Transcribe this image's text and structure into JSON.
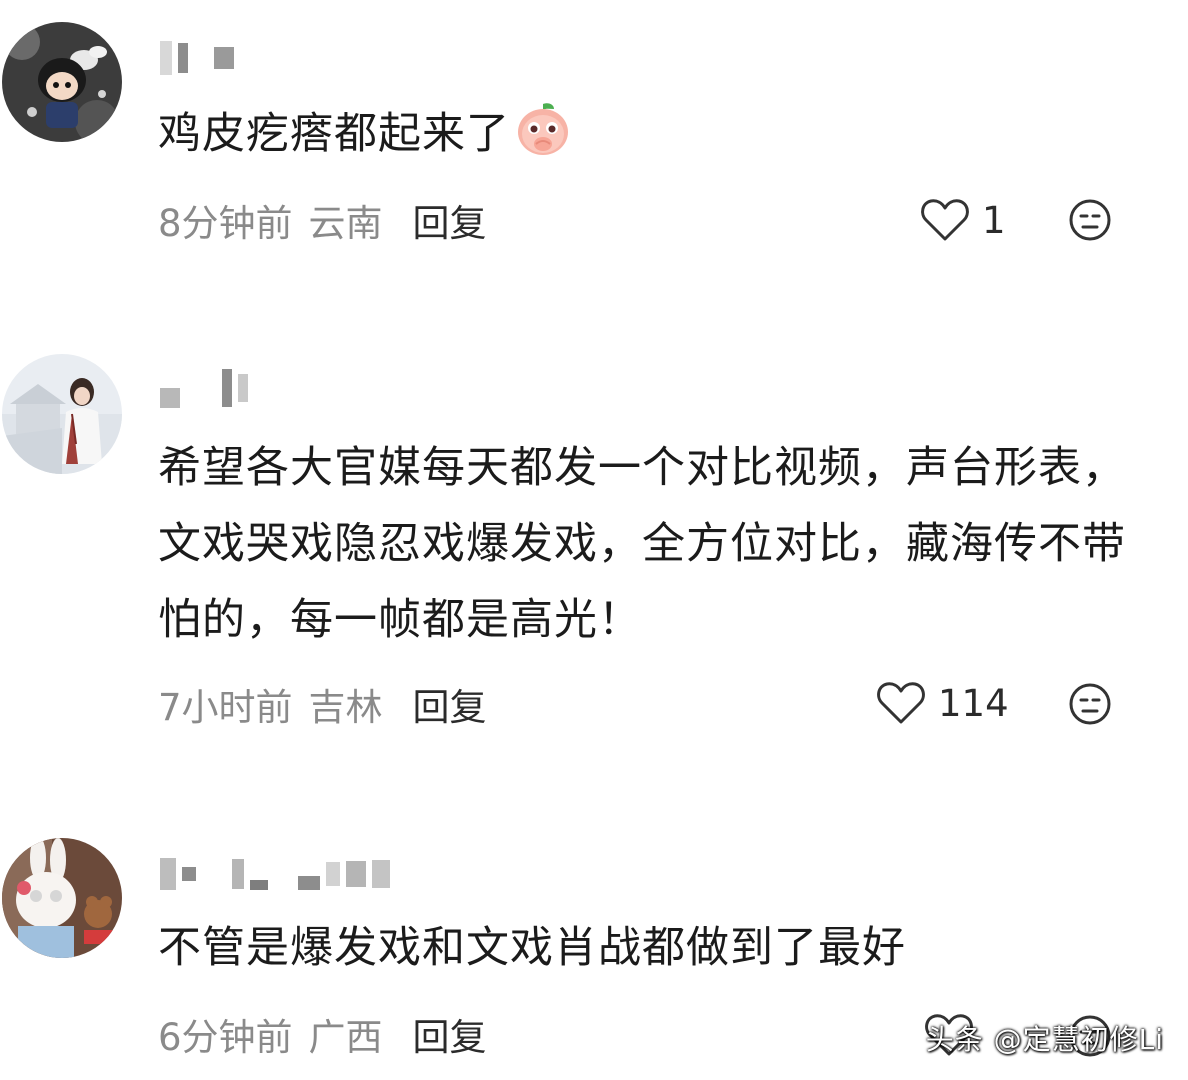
{
  "comments": [
    {
      "text": "鸡皮疙瘩都起来了",
      "time": "8分钟前",
      "region": "云南",
      "reply_label": "回复",
      "likes": "1"
    },
    {
      "text": "希望各大官媒每天都发一个对比视频，声台形表，文戏哭戏隐忍戏爆发戏，全方位对比，藏海传不带怕的，每一帧都是高光！",
      "time": "7小时前",
      "region": "吉林",
      "reply_label": "回复",
      "likes": "114"
    },
    {
      "text": "不管是爆发戏和文戏肖战都做到了最好",
      "time": "6分钟前",
      "region": "广西",
      "reply_label": "回复",
      "likes": ""
    }
  ],
  "watermark": "头条 @定慧初修Li",
  "icons": {
    "like": "heart-outline-icon",
    "dislike": "meh-face-icon",
    "emoji": "peach-praying-emoji"
  },
  "colors": {
    "text": "#1b1b1b",
    "meta": "#8a8a8a"
  }
}
